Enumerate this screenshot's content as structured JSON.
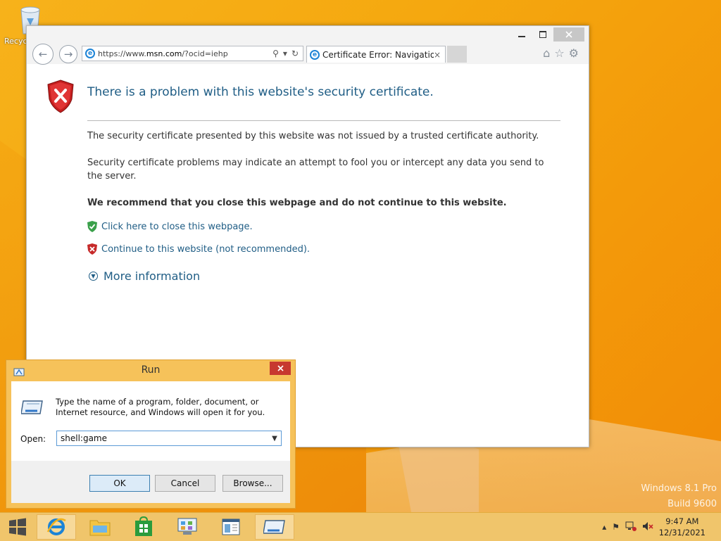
{
  "desktop": {
    "recycle_label": "Recyc",
    "watermark_line1": "Windows 8.1 Pro",
    "watermark_line2": "Build 9600"
  },
  "ie": {
    "address_prefix": "https://www.",
    "address_domain": "msn.com",
    "address_suffix": "/?ocid=iehp",
    "tab_title": "Certificate Error: Navigation...",
    "tab_close": "×"
  },
  "cert_error": {
    "title": "There is a problem with this website's security certificate.",
    "para1": "The security certificate presented by this website was not issued by a trusted certificate authority.",
    "para2": "Security certificate problems may indicate an attempt to fool you or intercept any data you send to the server.",
    "recommend": "We recommend that you close this webpage and do not continue to this website.",
    "close_link": "Click here to close this webpage.",
    "continue_link": "Continue to this website (not recommended).",
    "more_info": "More information"
  },
  "run": {
    "title": "Run",
    "description": "Type the name of a program, folder, document, or Internet resource, and Windows will open it for you.",
    "open_label": "Open:",
    "open_value": "shell:game",
    "ok": "OK",
    "cancel": "Cancel",
    "browse": "Browse..."
  },
  "taskbar": {
    "time": "9:47 AM",
    "date": "12/31/2021"
  }
}
